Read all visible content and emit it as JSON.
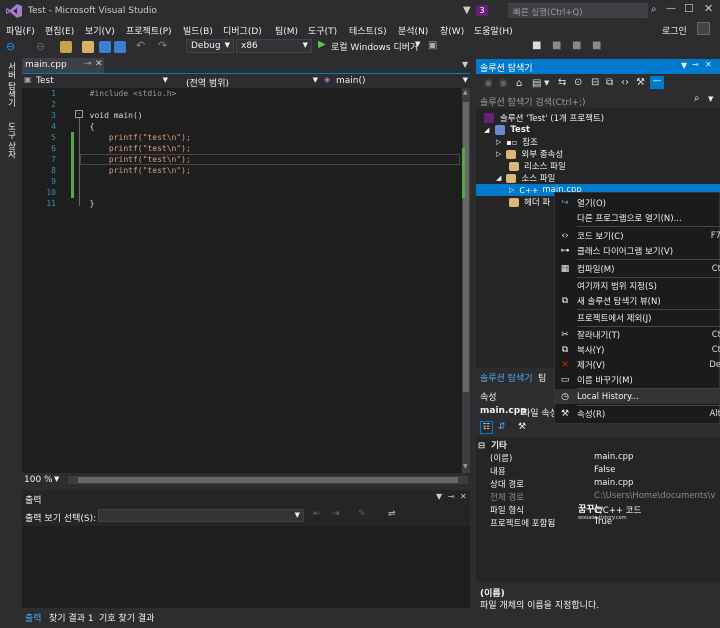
{
  "title_bar": {
    "title": "Test - Microsoft Visual Studio",
    "notification_count": "3",
    "quick_launch_placeholder": "빠른 실행(Ctrl+Q)"
  },
  "menu": {
    "items": [
      "파일(F)",
      "편집(E)",
      "보기(V)",
      "프로젝트(P)",
      "빌드(B)",
      "디버그(D)",
      "팀(M)",
      "도구(T)",
      "테스트(S)",
      "분석(N)",
      "창(W)",
      "도움말(H)"
    ],
    "login": "로그인"
  },
  "toolbar": {
    "config": "Debug",
    "platform": "x86",
    "run_label": "로컬 Windows 디버거"
  },
  "left_rail": {
    "tabs": [
      "서버 탐색기",
      "도구 상자"
    ]
  },
  "editor": {
    "tab": "main.cpp",
    "nav_project": "Test",
    "nav_scope": "(전역 범위)",
    "nav_member": "main()",
    "line_numbers": [
      "1",
      "2",
      "3",
      "4",
      "5",
      "6",
      "7",
      "8",
      "9",
      "10",
      "11"
    ],
    "lines": [
      "  #include <stdio.h>",
      "",
      "  void main()",
      "  {",
      "      printf(\"test\\n\");",
      "      printf(\"test\\n\");",
      "      printf(\"test\\n\");",
      "      printf(\"test\\n\");",
      "",
      "",
      "  }"
    ],
    "zoom": "100 %"
  },
  "output": {
    "title": "출력",
    "source_label": "출력 보기 선택(S):",
    "tabs": [
      "출력",
      "찾기 결과 1",
      "기호 찾기 결과"
    ]
  },
  "solution_explorer": {
    "title": "솔루션 탐색기",
    "search_placeholder": "솔루션 탐색기 검색(Ctrl+;)",
    "tree": {
      "solution": "솔루션 'Test' (1개 프로젝트)",
      "project": "Test",
      "references": "참조",
      "external_deps": "외부 종속성",
      "resource_files": "리소스 파일",
      "source_files": "소스 파일",
      "main_cpp": "main.cpp",
      "header_files": "헤더 파"
    },
    "bottom_tabs": [
      "솔루션 탐색기",
      "팀 "
    ]
  },
  "properties": {
    "title": "속성",
    "object_name": "main.cpp",
    "object_type": "파일 속성",
    "category": "기타",
    "rows": [
      {
        "key": "(이름)",
        "value": "main.cpp"
      },
      {
        "key": "내용",
        "value": "False"
      },
      {
        "key": "상대 경로",
        "value": "main.cpp"
      },
      {
        "key": "전체 경로",
        "value": "C:\\Users\\Home\\documents\\v"
      },
      {
        "key": "파일 형식",
        "value": "C/C++ 코드"
      },
      {
        "key": "프로젝트에 포함됨",
        "value": "True"
      }
    ],
    "desc_title": "(이름)",
    "desc_text": "파일 개체의 이름을 지정합니다.",
    "watermark_title": "꿈꾸는 ",
    "watermark_url": "wooaoe.tistory.com"
  },
  "context_menu": {
    "items": [
      {
        "label": "열기(O)",
        "key": ""
      },
      {
        "label": "다른 프로그램으로 열기(N)...",
        "key": ""
      },
      {
        "label": "코드 보기(C)",
        "key": "F7"
      },
      {
        "label": "클래스 다이어그램 보기(V)",
        "key": ""
      },
      {
        "label": "컴파일(M)",
        "key": "Ct"
      },
      {
        "label": "여기까지 범위 지정(S)",
        "key": ""
      },
      {
        "label": "새 솔루션 탐색기 뷰(N)",
        "key": ""
      },
      {
        "label": "프로젝트에서 제외(J)",
        "key": ""
      },
      {
        "label": "잘라내기(T)",
        "key": "Ct"
      },
      {
        "label": "복사(Y)",
        "key": "Ct"
      },
      {
        "label": "제거(V)",
        "key": "De"
      },
      {
        "label": "이름 바꾸기(M)",
        "key": ""
      },
      {
        "label": "Local History...",
        "key": ""
      },
      {
        "label": "속성(R)",
        "key": "Alt"
      }
    ]
  },
  "colors": {
    "accent": "#007acc",
    "vs_purple": "#68217a",
    "keyword": "#569cd6",
    "string": "#d69d85"
  }
}
